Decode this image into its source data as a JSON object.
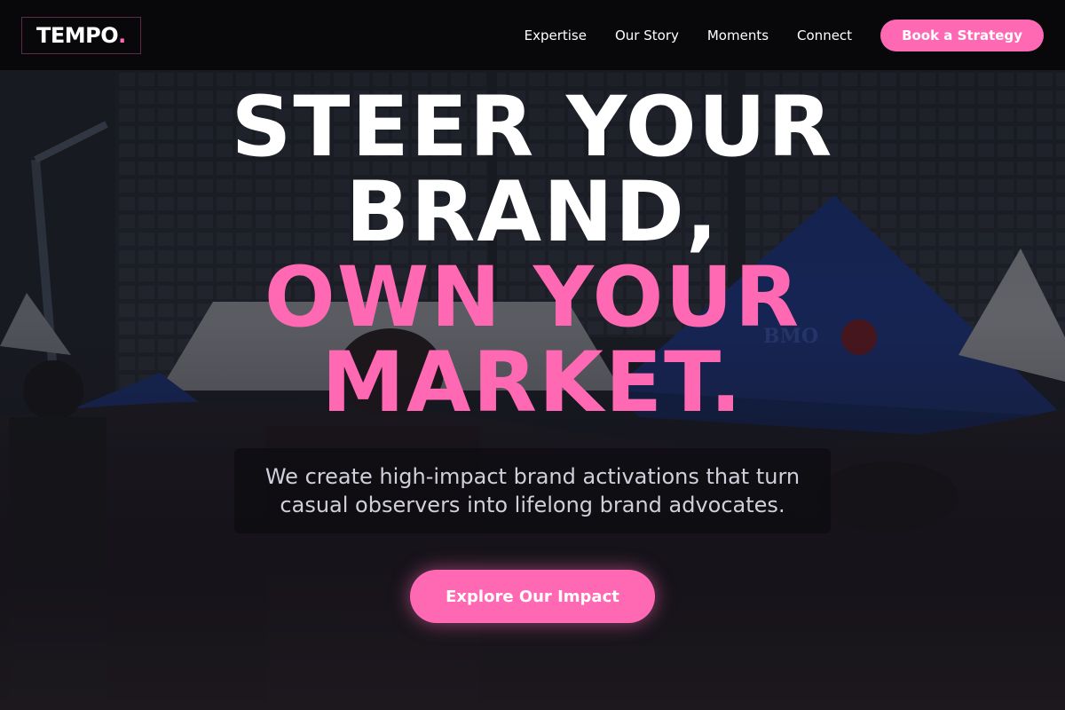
{
  "brand": {
    "name": "TEMPO",
    "dot": ".",
    "accent_color": "#ff69b4"
  },
  "nav": {
    "links": [
      "Expertise",
      "Our Story",
      "Moments",
      "Connect"
    ],
    "cta_label": "Book a Strategy"
  },
  "hero": {
    "headline_white": [
      "STEER YOUR",
      "BRAND,"
    ],
    "headline_pink": [
      "OWN YOUR",
      "MARKET."
    ],
    "subtext": "We create high-impact brand activations that turn casual observers into lifelong brand advocates.",
    "cta_label": "Explore Our Impact",
    "background_sign": "BMO"
  }
}
